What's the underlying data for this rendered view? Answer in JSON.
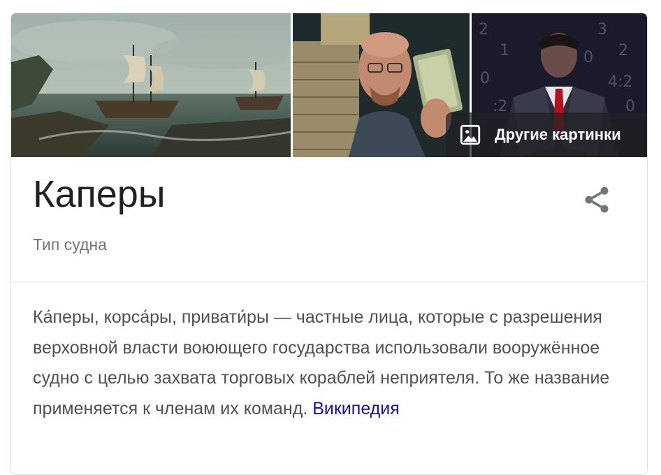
{
  "images": [
    {
      "alt": "",
      "icon": "sailing-ships-painting"
    },
    {
      "alt": "",
      "icon": "man-with-money-stacks"
    },
    {
      "alt": "",
      "icon": "man-in-suit-with-numbers"
    }
  ],
  "more_images": {
    "label": "Другие картинки",
    "icon": "image-icon"
  },
  "entity": {
    "title": "Каперы",
    "subtitle": "Тип судна"
  },
  "share": {
    "icon": "share-icon"
  },
  "description": {
    "text": "Ка́перы, корса́ры, привати́ры — частные лица, которые с разрешения верховной власти воюющего государства использовали вооружённое судно с целью захвата торговых кораблей неприятеля. То же название применяется к членам их команд.",
    "source_link": "Википедия"
  },
  "colors": {
    "title": "#202124",
    "subtitle": "#70757a",
    "body": "#4d5156",
    "link": "#1a0dab",
    "border": "#dfe1e5"
  }
}
